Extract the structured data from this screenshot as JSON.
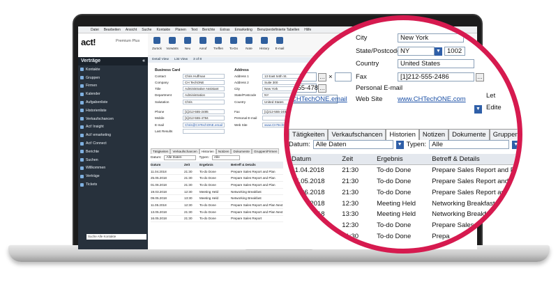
{
  "menu": [
    "Datei",
    "Bearbeiten",
    "Ansicht",
    "Suche",
    "Kontakte",
    "Planen",
    "Text",
    "Berichte",
    "Extras",
    "Emarketing",
    "Benutzerdefinierte Tabellen",
    "Hilfe"
  ],
  "app": {
    "logo": "act!",
    "edition": "Premium Plus"
  },
  "toolbar": [
    {
      "label": "Zurück",
      "icon": "arrow-left-icon"
    },
    {
      "label": "Vorwärts",
      "icon": "arrow-right-icon"
    },
    {
      "label": "Neu",
      "icon": "new-icon"
    },
    {
      "label": "Anruf",
      "icon": "phone-icon"
    },
    {
      "label": "Treffen",
      "icon": "meeting-icon"
    },
    {
      "label": "To-Do",
      "icon": "todo-icon"
    },
    {
      "label": "Note",
      "icon": "note-icon"
    },
    {
      "label": "History",
      "icon": "history-icon"
    },
    {
      "label": "E-mail",
      "icon": "email-icon"
    }
  ],
  "view_tabs": [
    "Detail View",
    "List View",
    "3 of 8"
  ],
  "sidebar": {
    "title": "Verträge",
    "items": [
      "Kontakte",
      "Gruppen",
      "Firmen",
      "Kalender",
      "Aufgabenliste",
      "Historienliste",
      "Verkaufschancen",
      "Act! Insight",
      "Act! emarketing",
      "Act! Connect",
      "Berichte",
      "Suchen",
      "Willkommen",
      "Verträge",
      "Tickets"
    ],
    "footer": "Suche Alle Kontakte"
  },
  "business_card": {
    "heading": "Business Card",
    "fields": [
      {
        "label": "Contact",
        "value": "Chris Huffman"
      },
      {
        "label": "Company",
        "value": "CH TechONE"
      },
      {
        "label": "Title",
        "value": "Administrative Assistant"
      },
      {
        "label": "Department",
        "value": "Administration"
      },
      {
        "label": "Salutation",
        "value": "Chris"
      },
      {
        "label": "Phone",
        "value": "[1]212-555-2485"
      },
      {
        "label": "Mobile",
        "value": "[1]212-555-4784"
      },
      {
        "label": "E-mail",
        "value": "Chris@CHTechONE.email"
      },
      {
        "label": "Last Results",
        "value": ""
      }
    ]
  },
  "address": {
    "heading": "Address",
    "fields": [
      {
        "label": "Address 1",
        "value": "13 East 54th St."
      },
      {
        "label": "Address 2",
        "value": "Suite 300"
      },
      {
        "label": "City",
        "value": "New York"
      },
      {
        "label": "State/Postcode",
        "value": "NY"
      },
      {
        "label": "Country",
        "value": "United States"
      },
      {
        "label": "Fax",
        "value": "[1]212-555-2486"
      },
      {
        "label": "Personal E-mail",
        "value": ""
      },
      {
        "label": "Web Site",
        "value": "www.CHTechONE.com"
      }
    ]
  },
  "lower_tabs": [
    "Tätigkeiten",
    "Verkaufschancen",
    "Historien",
    "Notizen",
    "Dokumente",
    "Gruppen/Firmen"
  ],
  "filter": {
    "date_label": "Datum:",
    "date_value": "Alle Daten",
    "type_label": "Typen:",
    "type_value": "Alle"
  },
  "history": {
    "columns": [
      "Datum",
      "Zeit",
      "Ergebnis",
      "Betreff & Details"
    ],
    "rows": [
      [
        "11.04.2018",
        "21:30",
        "To-do Done",
        "Prepare Sales Report and Plan"
      ],
      [
        "25.05.2018",
        "21:30",
        "To-do Done",
        "Prepare Sales Report and Plan"
      ],
      [
        "01.06.2018",
        "21:30",
        "To-do Done",
        "Prepare Sales Report and Plan"
      ],
      [
        "19.03.2018",
        "12:30",
        "Meeting Held",
        "Networking Breakfast"
      ],
      [
        "09.05.2018",
        "13:30",
        "Meeting Held",
        "Networking Breakfast"
      ],
      [
        "11.05.2018",
        "12:30",
        "To-do Done",
        "Prepare Sales Report and Plan Next Week"
      ],
      [
        "13.05.2018",
        "21:30",
        "To-do Done",
        "Prepare Sales Report and Plan Next Week"
      ],
      [
        "16.05.2018",
        "21:30",
        "To-do Done",
        "Prepare Sales Report"
      ]
    ]
  },
  "magnifier": {
    "city": "New York",
    "state": "NY",
    "postcode": "1002",
    "country": "United States",
    "phone_partial": "485",
    "mobile_partial": "-555-4784",
    "email_partial": "CHTechONE.email",
    "fax": "[1]212-555-2486",
    "website": "www.CHTechONE.com",
    "side_labels": [
      "Let",
      "Edite"
    ],
    "history_dates": [
      "11.04.2018",
      "25.05.2018",
      "01.06.2018",
      "19.03.2018",
      "09.05.2018",
      "11.05.2018",
      "13.05.2018"
    ],
    "history_times": [
      "21:30",
      "21:30",
      "21:30",
      "12:30",
      "13:30",
      "12:30",
      "21:30"
    ],
    "history_results": [
      "To-do Done",
      "To-do Done",
      "To-do Done",
      "Meeting Held",
      "Meeting Held",
      "To-do Done",
      "To-do Done"
    ],
    "history_subjects": [
      "Prepare Sales Report and P",
      "Prepare Sales Report and",
      "Prepare Sales Report and",
      "Networking Breakfast",
      "Networking Breakfa",
      "Prepare Sales Repor",
      "Prepa"
    ]
  },
  "colors": {
    "accent": "#d61a4f",
    "sidebar": "#27313c",
    "link": "#1a4fa6"
  }
}
